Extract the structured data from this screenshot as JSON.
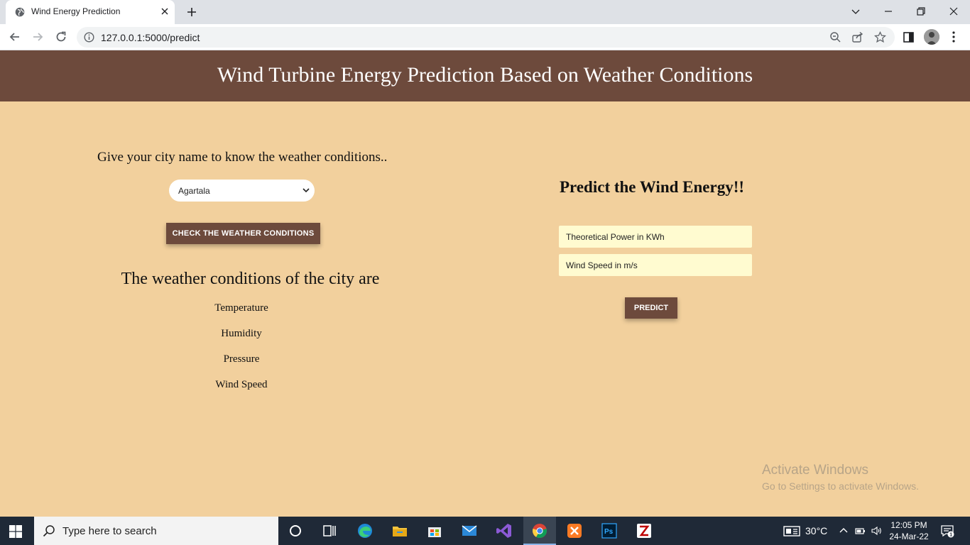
{
  "browser": {
    "tab_title": "Wind Energy Prediction",
    "url": "127.0.0.1:5000/predict"
  },
  "page": {
    "title": "Wind Turbine Energy Prediction Based on Weather Conditions",
    "city_prompt": "Give your city name to know the weather conditions..",
    "city_select": {
      "selected": "Agartala"
    },
    "check_button_label": "CHECK THE WEATHER CONDITIONS",
    "weather_heading": "The weather conditions of the city are",
    "weather_items": [
      "Temperature",
      "Humidity",
      "Pressure",
      "Wind Speed"
    ],
    "predict_heading": "Predict the Wind Energy!!",
    "inputs": {
      "theoretical_power_placeholder": "Theoretical Power in KWh",
      "wind_speed_placeholder": "Wind Speed in m/s"
    },
    "predict_button_label": "PREDICT"
  },
  "watermark": {
    "title": "Activate Windows",
    "subtitle": "Go to Settings to activate Windows."
  },
  "taskbar": {
    "search_placeholder": "Type here to search",
    "temperature": "30°C",
    "time": "12:05 PM",
    "date": "24-Mar-22",
    "notification_count": "1"
  },
  "colors": {
    "header_bg": "#6d4a3c",
    "page_bg": "#f2d09d",
    "input_bg": "#fffbd0",
    "taskbar_bg": "#1f2937"
  }
}
